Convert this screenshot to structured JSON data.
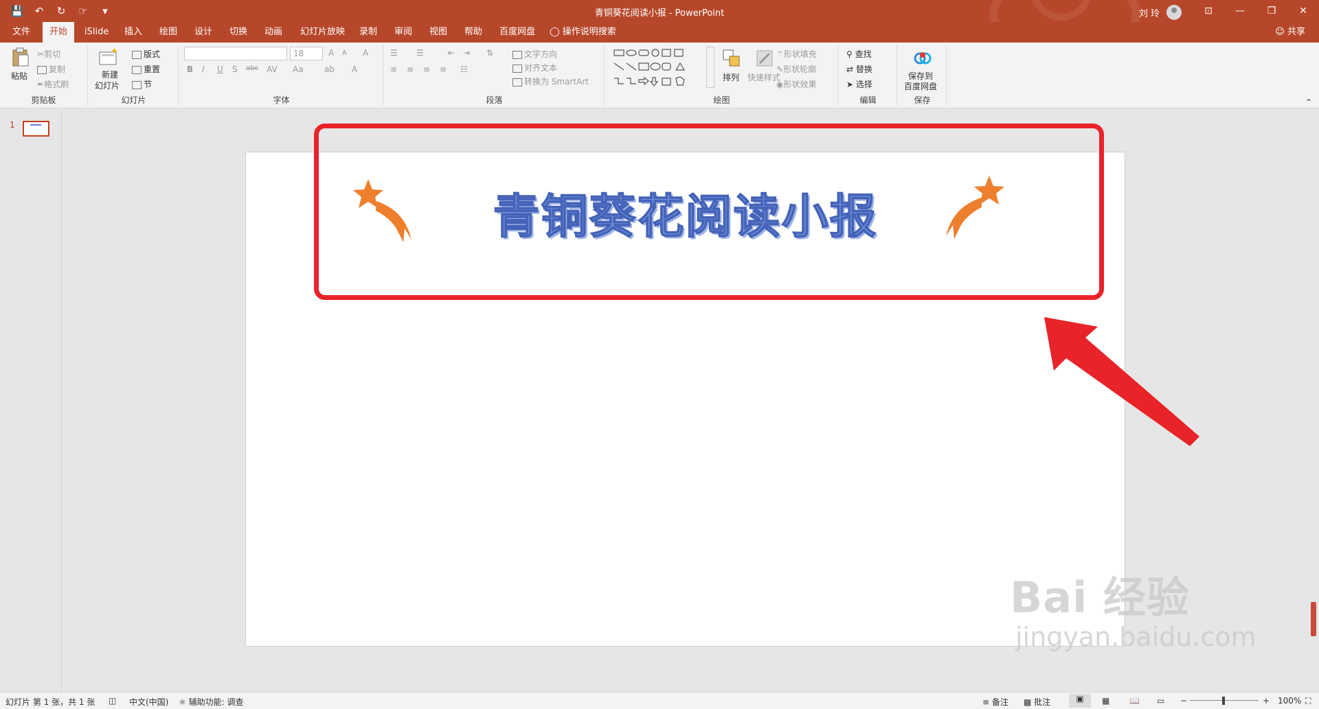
{
  "titlebar": {
    "doc_title": "青铜葵花阅读小报  -  PowerPoint",
    "user_name": "刘 玲",
    "qat": {
      "save": "💾",
      "undo": "↶",
      "redo": "↻",
      "touch": "☞",
      "more": "▾"
    },
    "window_buttons": {
      "ribbon_display": "⊡",
      "minimize": "—",
      "restore": "❐",
      "close": "✕"
    }
  },
  "tabs": {
    "items": [
      "文件",
      "开始",
      "iSlide",
      "插入",
      "绘图",
      "设计",
      "切换",
      "动画",
      "幻灯片放映",
      "录制",
      "审阅",
      "视图",
      "帮助",
      "百度网盘"
    ],
    "active": "开始",
    "tell_me": "操作说明搜索",
    "share": "共享"
  },
  "ribbon": {
    "clipboard": {
      "paste": "粘贴",
      "cut": "剪切",
      "copy": "复制",
      "format_painter": "格式刷",
      "label": "剪贴板"
    },
    "slides": {
      "new_slide_line1": "新建",
      "new_slide_line2": "幻灯片",
      "layout": "版式",
      "reset": "重置",
      "section": "节",
      "label": "幻灯片"
    },
    "font": {
      "font_name": "",
      "font_size": "18",
      "bold": "B",
      "italic": "I",
      "underline": "U",
      "shadow": "S",
      "strike": "abc",
      "spacing": "AV",
      "case": "Aa",
      "grow": "A",
      "shrink": "A",
      "clear": "A",
      "highlight": "ab",
      "color": "A",
      "label": "字体"
    },
    "paragraph": {
      "text_direction": "文字方向",
      "align_text": "对齐文本",
      "smartart": "转换为 SmartArt",
      "label": "段落"
    },
    "drawing": {
      "arrange": "排列",
      "quick_styles": "快速样式",
      "shape_fill": "形状填充",
      "shape_outline": "形状轮廓",
      "shape_effects": "形状效果",
      "label": "绘图"
    },
    "editing": {
      "find": "查找",
      "replace": "替换",
      "select": "选择",
      "label": "编辑"
    },
    "save": {
      "line1": "保存到",
      "line2": "百度网盘",
      "label": "保存"
    }
  },
  "thumbs": {
    "slide_number": "1"
  },
  "slide": {
    "title": "青铜葵花阅读小报"
  },
  "statusbar": {
    "slide_info": "幻灯片 第 1 张，共 1 张",
    "language": "中文(中国)",
    "accessibility": "辅助功能: 调查",
    "notes": "备注",
    "comments": "批注",
    "zoom": "100%",
    "zoom_minus": "−",
    "zoom_plus": "+"
  },
  "watermark": {
    "main": "Bai  经验",
    "sub": "jingyan.baidu.com"
  },
  "colors": {
    "accent": "#b7472a",
    "title_fill": "#6f8fd8",
    "star": "#ee7f2d",
    "highlight": "#e8232a"
  }
}
